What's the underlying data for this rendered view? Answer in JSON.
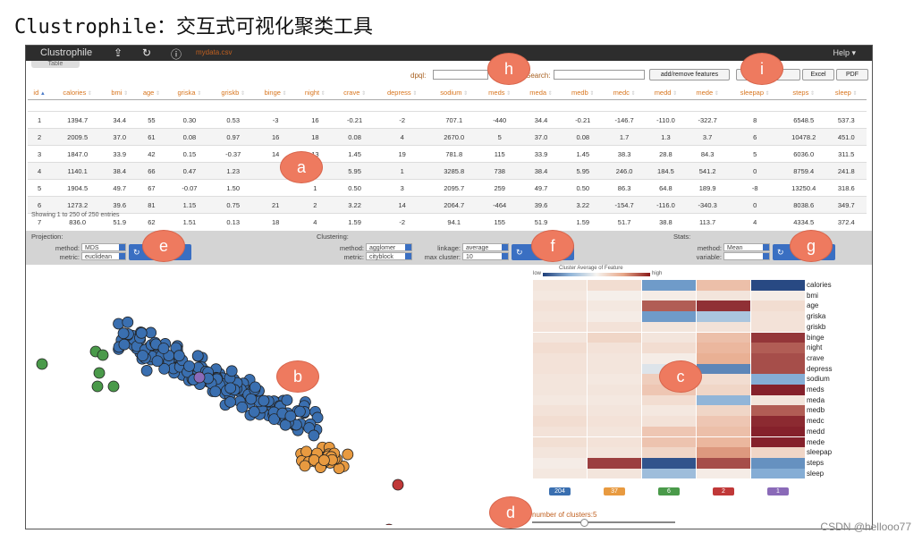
{
  "heading": "Clustrophile：交互式可视化聚类工具",
  "app": {
    "brand": "Clustrophile",
    "file": "mydata.csv",
    "help": "Help ▾"
  },
  "table_tab": "Table",
  "toolbar": {
    "dpql": "dpql:",
    "search": "Search:",
    "add_remove": "add/remove features",
    "csv": "CSV",
    "excel": "Excel",
    "pdf": "PDF"
  },
  "columns": [
    "id",
    "calories",
    "bmi",
    "age",
    "griska",
    "griskb",
    "binge",
    "night",
    "crave",
    "depress",
    "sodium",
    "meds",
    "meda",
    "medb",
    "medc",
    "medd",
    "mede",
    "sleepap",
    "steps",
    "sleep"
  ],
  "rows": [
    [
      "1",
      "1394.7",
      "34.4",
      "55",
      "0.30",
      "0.53",
      "-3",
      "16",
      "-0.21",
      "-2",
      "707.1",
      "-440",
      "34.4",
      "-0.21",
      "-146.7",
      "-110.0",
      "-322.7",
      "8",
      "6548.5",
      "537.3"
    ],
    [
      "2",
      "2009.5",
      "37.0",
      "61",
      "0.08",
      "0.97",
      "16",
      "18",
      "0.08",
      "4",
      "2670.0",
      "5",
      "37.0",
      "0.08",
      "1.7",
      "1.3",
      "3.7",
      "6",
      "10478.2",
      "451.0"
    ],
    [
      "3",
      "1847.0",
      "33.9",
      "42",
      "0.15",
      "-0.37",
      "14",
      "13",
      "1.45",
      "19",
      "781.8",
      "115",
      "33.9",
      "1.45",
      "38.3",
      "28.8",
      "84.3",
      "5",
      "6036.0",
      "311.5"
    ],
    [
      "4",
      "1140.1",
      "38.4",
      "66",
      "0.47",
      "1.23",
      "",
      "8",
      "5.95",
      "1",
      "3285.8",
      "738",
      "38.4",
      "5.95",
      "246.0",
      "184.5",
      "541.2",
      "0",
      "8759.4",
      "241.8"
    ],
    [
      "5",
      "1904.5",
      "49.7",
      "67",
      "-0.07",
      "1.50",
      "",
      "1",
      "0.50",
      "3",
      "2095.7",
      "259",
      "49.7",
      "0.50",
      "86.3",
      "64.8",
      "189.9",
      "-8",
      "13250.4",
      "318.6"
    ],
    [
      "6",
      "1273.2",
      "39.6",
      "81",
      "1.15",
      "0.75",
      "21",
      "2",
      "3.22",
      "14",
      "2064.7",
      "-464",
      "39.6",
      "3.22",
      "-154.7",
      "-116.0",
      "-340.3",
      "0",
      "8038.6",
      "349.7"
    ],
    [
      "7",
      "836.0",
      "51.9",
      "62",
      "1.51",
      "0.13",
      "18",
      "4",
      "1.59",
      "-2",
      "94.1",
      "155",
      "51.9",
      "1.59",
      "51.7",
      "38.8",
      "113.7",
      "4",
      "4334.5",
      "372.4"
    ]
  ],
  "showing": "Showing 1 to 250 of 250 entries",
  "projection": {
    "title": "Projection:",
    "method_label": "method:",
    "method": "MDS",
    "metric_label": "metric:",
    "metric": "euclidean"
  },
  "clustering": {
    "title": "Clustering:",
    "method_label": "method:",
    "method": "agglomer",
    "metric_label": "metric:",
    "metric": "cityblock",
    "linkage_label": "linkage:",
    "linkage": "average",
    "max_label": "max cluster:",
    "max": "10"
  },
  "stats": {
    "title": "Stats:",
    "method_label": "method:",
    "method": "Mean",
    "variable_label": "variable:"
  },
  "markers": [
    "a",
    "b",
    "c",
    "d",
    "e",
    "f",
    "g",
    "h",
    "i"
  ],
  "heatmap": {
    "title": "Cluster Average of Feature",
    "low": "low",
    "high": "high",
    "features": [
      "calories",
      "bmi",
      "age",
      "griska",
      "griskb",
      "binge",
      "night",
      "crave",
      "depress",
      "sodium",
      "meds",
      "meda",
      "medb",
      "medc",
      "medd",
      "mede",
      "sleepap",
      "steps",
      "sleep"
    ],
    "values": [
      [
        0.1,
        0.15,
        -0.55,
        0.35,
        -0.95
      ],
      [
        0.08,
        0.03,
        0.05,
        0.1,
        0.05
      ],
      [
        0.12,
        0.08,
        0.75,
        0.9,
        0.15
      ],
      [
        0.1,
        0.05,
        -0.55,
        -0.3,
        0.12
      ],
      [
        0.12,
        0.12,
        0.1,
        0.12,
        0.12
      ],
      [
        0.1,
        0.2,
        0.1,
        0.35,
        0.88
      ],
      [
        0.15,
        0.12,
        0.15,
        0.4,
        0.75
      ],
      [
        0.12,
        0.1,
        0.05,
        0.45,
        0.8
      ],
      [
        0.12,
        0.1,
        -0.1,
        -0.65,
        0.8
      ],
      [
        0.1,
        0.08,
        0.25,
        0.15,
        -0.45
      ],
      [
        0.1,
        0.1,
        0.3,
        0.2,
        0.95
      ],
      [
        0.08,
        0.08,
        0.15,
        -0.4,
        0.1
      ],
      [
        0.12,
        0.1,
        0.08,
        0.2,
        0.75
      ],
      [
        0.15,
        0.12,
        0.12,
        0.3,
        0.92
      ],
      [
        0.12,
        0.1,
        0.3,
        0.35,
        0.95
      ],
      [
        0.14,
        0.12,
        0.32,
        0.4,
        0.95
      ],
      [
        0.1,
        0.1,
        0.2,
        0.55,
        0.2
      ],
      [
        0.05,
        0.85,
        -0.9,
        0.8,
        -0.6
      ],
      [
        0.08,
        0.1,
        -0.35,
        0.05,
        -0.45
      ]
    ]
  },
  "cluster_sizes": [
    {
      "count": "204",
      "color": "#3a6fb0"
    },
    {
      "count": "37",
      "color": "#e89a40"
    },
    {
      "count": "6",
      "color": "#4a9a4a"
    },
    {
      "count": "2",
      "color": "#c03838"
    },
    {
      "count": "1",
      "color": "#8a6ab8"
    }
  ],
  "slider": {
    "label": "number of clusters:",
    "value": "5",
    "fraction": 0.36
  },
  "watermark": "CSDN @hellooo77"
}
